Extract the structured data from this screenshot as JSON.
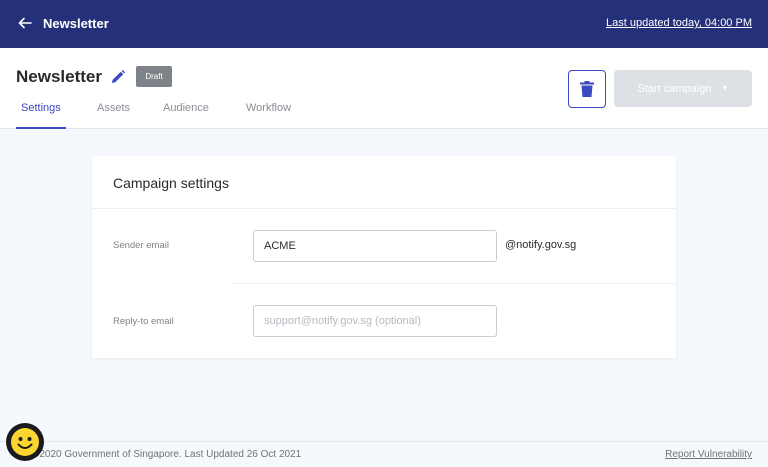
{
  "topbar": {
    "back_icon": "arrow-left-icon",
    "title": "Newsletter",
    "last_updated": "Last updated today, 04:00 PM"
  },
  "header": {
    "campaign_title": "Newsletter",
    "edit_icon": "pencil-icon",
    "status_badge": "Draft",
    "tabs": [
      {
        "label": "Settings",
        "active": true
      },
      {
        "label": "Assets",
        "active": false
      },
      {
        "label": "Audience",
        "active": false
      },
      {
        "label": "Workflow",
        "active": false
      }
    ],
    "delete_icon": "trash-icon",
    "start_campaign_label": "Start campaign"
  },
  "settings_card": {
    "title": "Campaign settings",
    "sender_email": {
      "label": "Sender email",
      "value": "ACME",
      "suffix": "@notify.gov.sg"
    },
    "reply_to_email": {
      "label": "Reply-to email",
      "value": "",
      "placeholder": "support@notify.gov.sg (optional)"
    }
  },
  "footer": {
    "copyright": "©2020 Government of Singapore. Last Updated 26 Oct 2021",
    "report_link": "Report Vulnerability"
  },
  "chat_widget": {
    "icon": "smiley-face-icon"
  },
  "colors": {
    "topbar_bg": "#25307a",
    "accent": "#3b49c2",
    "badge_bg": "#7e8389",
    "disabled_button": "#dde0e4",
    "page_bg": "#f5f8fc",
    "chat_face": "#fbd530"
  }
}
